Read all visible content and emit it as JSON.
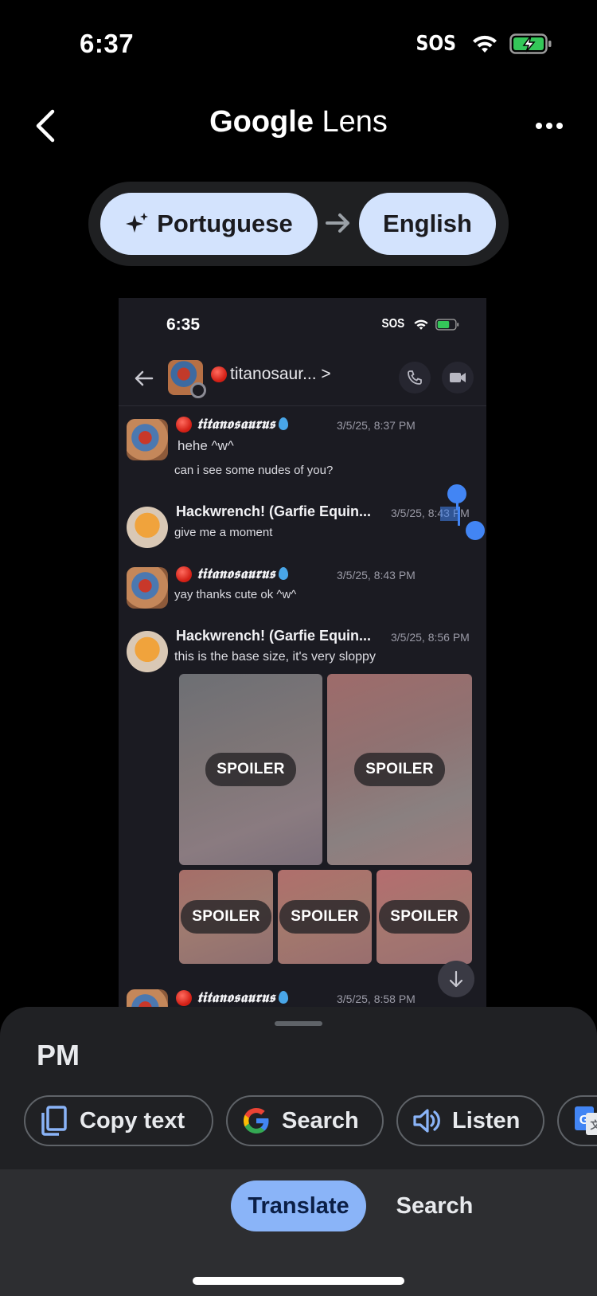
{
  "status_bar": {
    "time": "6:37",
    "carrier": "SOS"
  },
  "header": {
    "title_brand": "Google",
    "title_product": "Lens"
  },
  "language": {
    "source": "Portuguese",
    "target": "English"
  },
  "preview": {
    "time": "6:35",
    "carrier": "SOS",
    "channel": "titanosaur... >",
    "messages": [
      {
        "author": "𝖙𝖎𝖙𝖆𝖓𝖔𝖘𝖆𝖚𝖗𝖚𝖘",
        "timestamp": "3/5/25, 8:37 PM",
        "lines": [
          "hehe ^w^",
          "can i see some nudes of you?"
        ]
      },
      {
        "author": "Hackwrench! (Garfie Equin...",
        "timestamp": "3/5/25, 8:43 PM",
        "lines": [
          "give me a moment"
        ]
      },
      {
        "author": "𝖙𝖎𝖙𝖆𝖓𝖔𝖘𝖆𝖚𝖗𝖚𝖘",
        "timestamp": "3/5/25, 8:43 PM",
        "lines": [
          "yay thanks cute ok ^w^"
        ]
      },
      {
        "author": "Hackwrench! (Garfie Equin...",
        "timestamp": "3/5/25, 8:56 PM",
        "lines": [
          "this is the base size, it's very sloppy"
        ]
      },
      {
        "author": "𝖙𝖎𝖙𝖆𝖓𝖔𝖘𝖆𝖚𝖗𝖚𝖘",
        "timestamp": "3/5/25, 8:58 PM",
        "lines": []
      }
    ],
    "spoiler_label": "SPOILER"
  },
  "sheet": {
    "selected_text": "PM",
    "actions": {
      "copy": "Copy text",
      "search": "Search",
      "listen": "Listen"
    }
  },
  "modes": {
    "translate": "Translate",
    "search": "Search"
  },
  "colors": {
    "accent": "#8ab4f8",
    "pill": "#d3e3fd",
    "selection": "#4285f4"
  }
}
